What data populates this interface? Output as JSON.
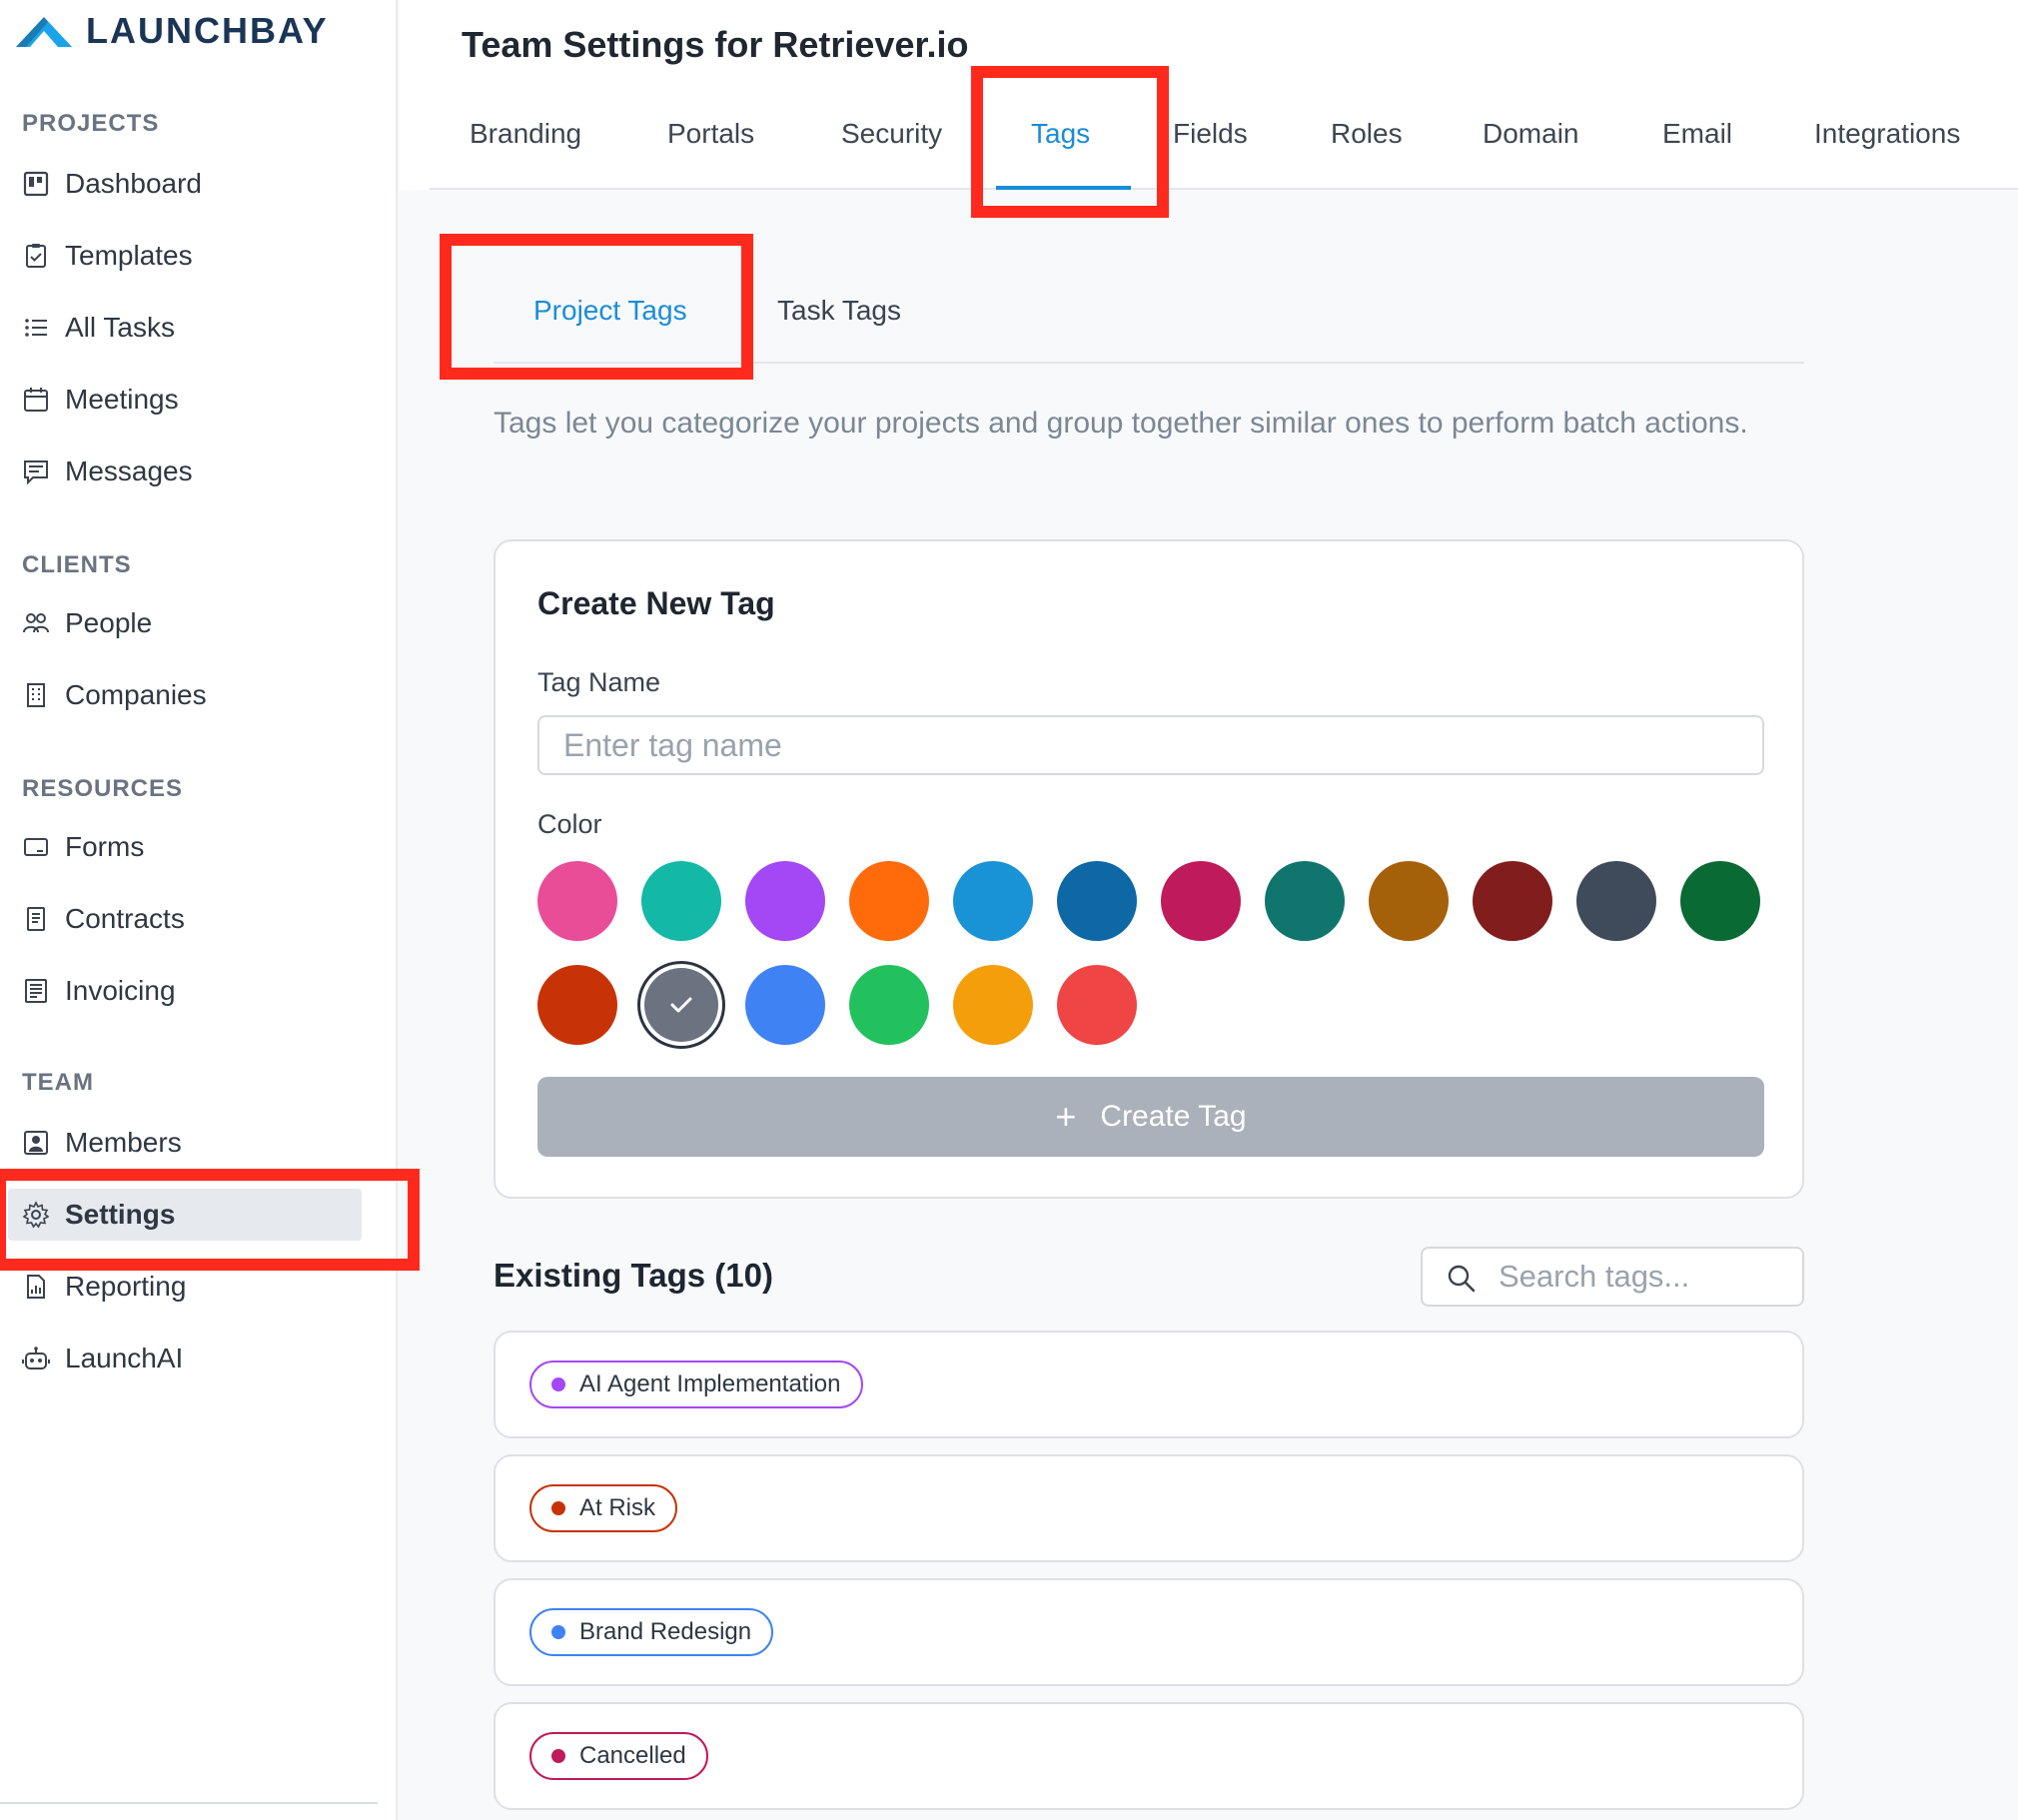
{
  "app": {
    "brand": "LAUNCHBAY"
  },
  "sidebar": {
    "sections": [
      {
        "title": "PROJECTS"
      },
      {
        "title": "CLIENTS"
      },
      {
        "title": "RESOURCES"
      },
      {
        "title": "TEAM"
      }
    ],
    "items": [
      {
        "label": "Dashboard",
        "icon": "dashboard-icon"
      },
      {
        "label": "Templates",
        "icon": "clipboard-icon"
      },
      {
        "label": "All Tasks",
        "icon": "list-icon"
      },
      {
        "label": "Meetings",
        "icon": "calendar-icon"
      },
      {
        "label": "Messages",
        "icon": "message-icon"
      },
      {
        "label": "People",
        "icon": "people-icon"
      },
      {
        "label": "Companies",
        "icon": "building-icon"
      },
      {
        "label": "Forms",
        "icon": "form-icon"
      },
      {
        "label": "Contracts",
        "icon": "document-icon"
      },
      {
        "label": "Invoicing",
        "icon": "invoice-icon"
      },
      {
        "label": "Members",
        "icon": "member-icon"
      },
      {
        "label": "Settings",
        "icon": "gear-icon",
        "active": true
      },
      {
        "label": "Reporting",
        "icon": "report-icon"
      },
      {
        "label": "LaunchAI",
        "icon": "robot-icon"
      }
    ]
  },
  "header": {
    "title": "Team Settings for Retriever.io",
    "tabs": [
      {
        "label": "Branding"
      },
      {
        "label": "Portals"
      },
      {
        "label": "Security"
      },
      {
        "label": "Tags",
        "active": true
      },
      {
        "label": "Fields"
      },
      {
        "label": "Roles"
      },
      {
        "label": "Domain"
      },
      {
        "label": "Email"
      },
      {
        "label": "Integrations"
      }
    ]
  },
  "subtabs": [
    {
      "label": "Project Tags",
      "active": true
    },
    {
      "label": "Task Tags"
    }
  ],
  "description": "Tags let you categorize your projects and group together similar ones to perform batch actions.",
  "create_tag": {
    "title": "Create New Tag",
    "name_label": "Tag Name",
    "name_placeholder": "Enter tag name",
    "color_label": "Color",
    "colors": [
      "#e94d98",
      "#14b8a6",
      "#a448f5",
      "#ff6a0b",
      "#1a92d6",
      "#0e68a5",
      "#bf1a5b",
      "#10766d",
      "#a5600a",
      "#811d1d",
      "#3f4b5a",
      "#096a33",
      "#c73306",
      "#6b7280",
      "#3f82f4",
      "#22c15e",
      "#f59e0b",
      "#ef4545"
    ],
    "selected_color": "#6b7280",
    "button_label": "Create Tag"
  },
  "existing": {
    "title": "Existing Tags (10)",
    "search_placeholder": "Search tags...",
    "tags": [
      {
        "name": "AI Agent Implementation",
        "color": "#a448f5"
      },
      {
        "name": "At Risk",
        "color": "#c73306"
      },
      {
        "name": "Brand Redesign",
        "color": "#3f82f4"
      },
      {
        "name": "Cancelled",
        "color": "#bf1a5b"
      }
    ]
  }
}
